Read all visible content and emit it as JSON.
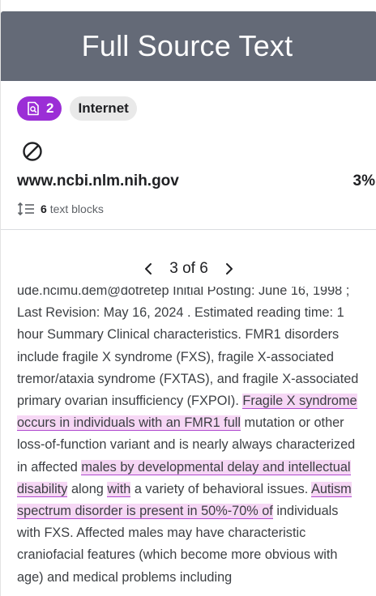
{
  "header": {
    "title": "Full Source Text"
  },
  "badges": {
    "count": "2",
    "type": "Internet"
  },
  "source": {
    "url": "www.ncbi.nlm.nih.gov",
    "percent": "3%"
  },
  "blocks": {
    "count": "6",
    "label": "text blocks"
  },
  "pager": {
    "label": "3 of 6"
  },
  "text": {
    "segments": [
      {
        "t": "ude.ncimu.dem@dotretep Initial Posting: June 16, 1998 ; Last Revision: May 16, 2024 . Estimated reading time: 1 hour Summary Clinical characteristics. FMR1 disorders include fragile X syndrome (FXS), fragile X-associated tremor/ataxia syndrome (FXTAS), and fragile X-associated primary ovarian insufficiency (FXPOI). ",
        "hl": false
      },
      {
        "t": "Fragile X syndrome occurs in individuals with an FMR1 full",
        "hl": true
      },
      {
        "t": " mutation or other loss-of-function variant and is nearly always characterized in affected ",
        "hl": false
      },
      {
        "t": "males by developmental delay and intellectual disability",
        "hl": true
      },
      {
        "t": " along ",
        "hl": false
      },
      {
        "t": "with",
        "hl": true
      },
      {
        "t": " a variety of behavioral issues. ",
        "hl": false
      },
      {
        "t": "Autism spectrum disorder is present in 50%-70% of",
        "hl": true
      },
      {
        "t": " individuals with FXS. Affected males may have characteristic craniofacial features (which become more obvious with age) and medical problems including",
        "hl": false
      }
    ]
  },
  "colors": {
    "header_bg": "#646a77",
    "badge_purple": "#9b2ed6",
    "highlight": "#f6d7f5"
  },
  "icons": [
    "document-search-icon",
    "excluded-icon",
    "line-spacing-icon",
    "chevron-left-icon",
    "chevron-right-icon"
  ]
}
